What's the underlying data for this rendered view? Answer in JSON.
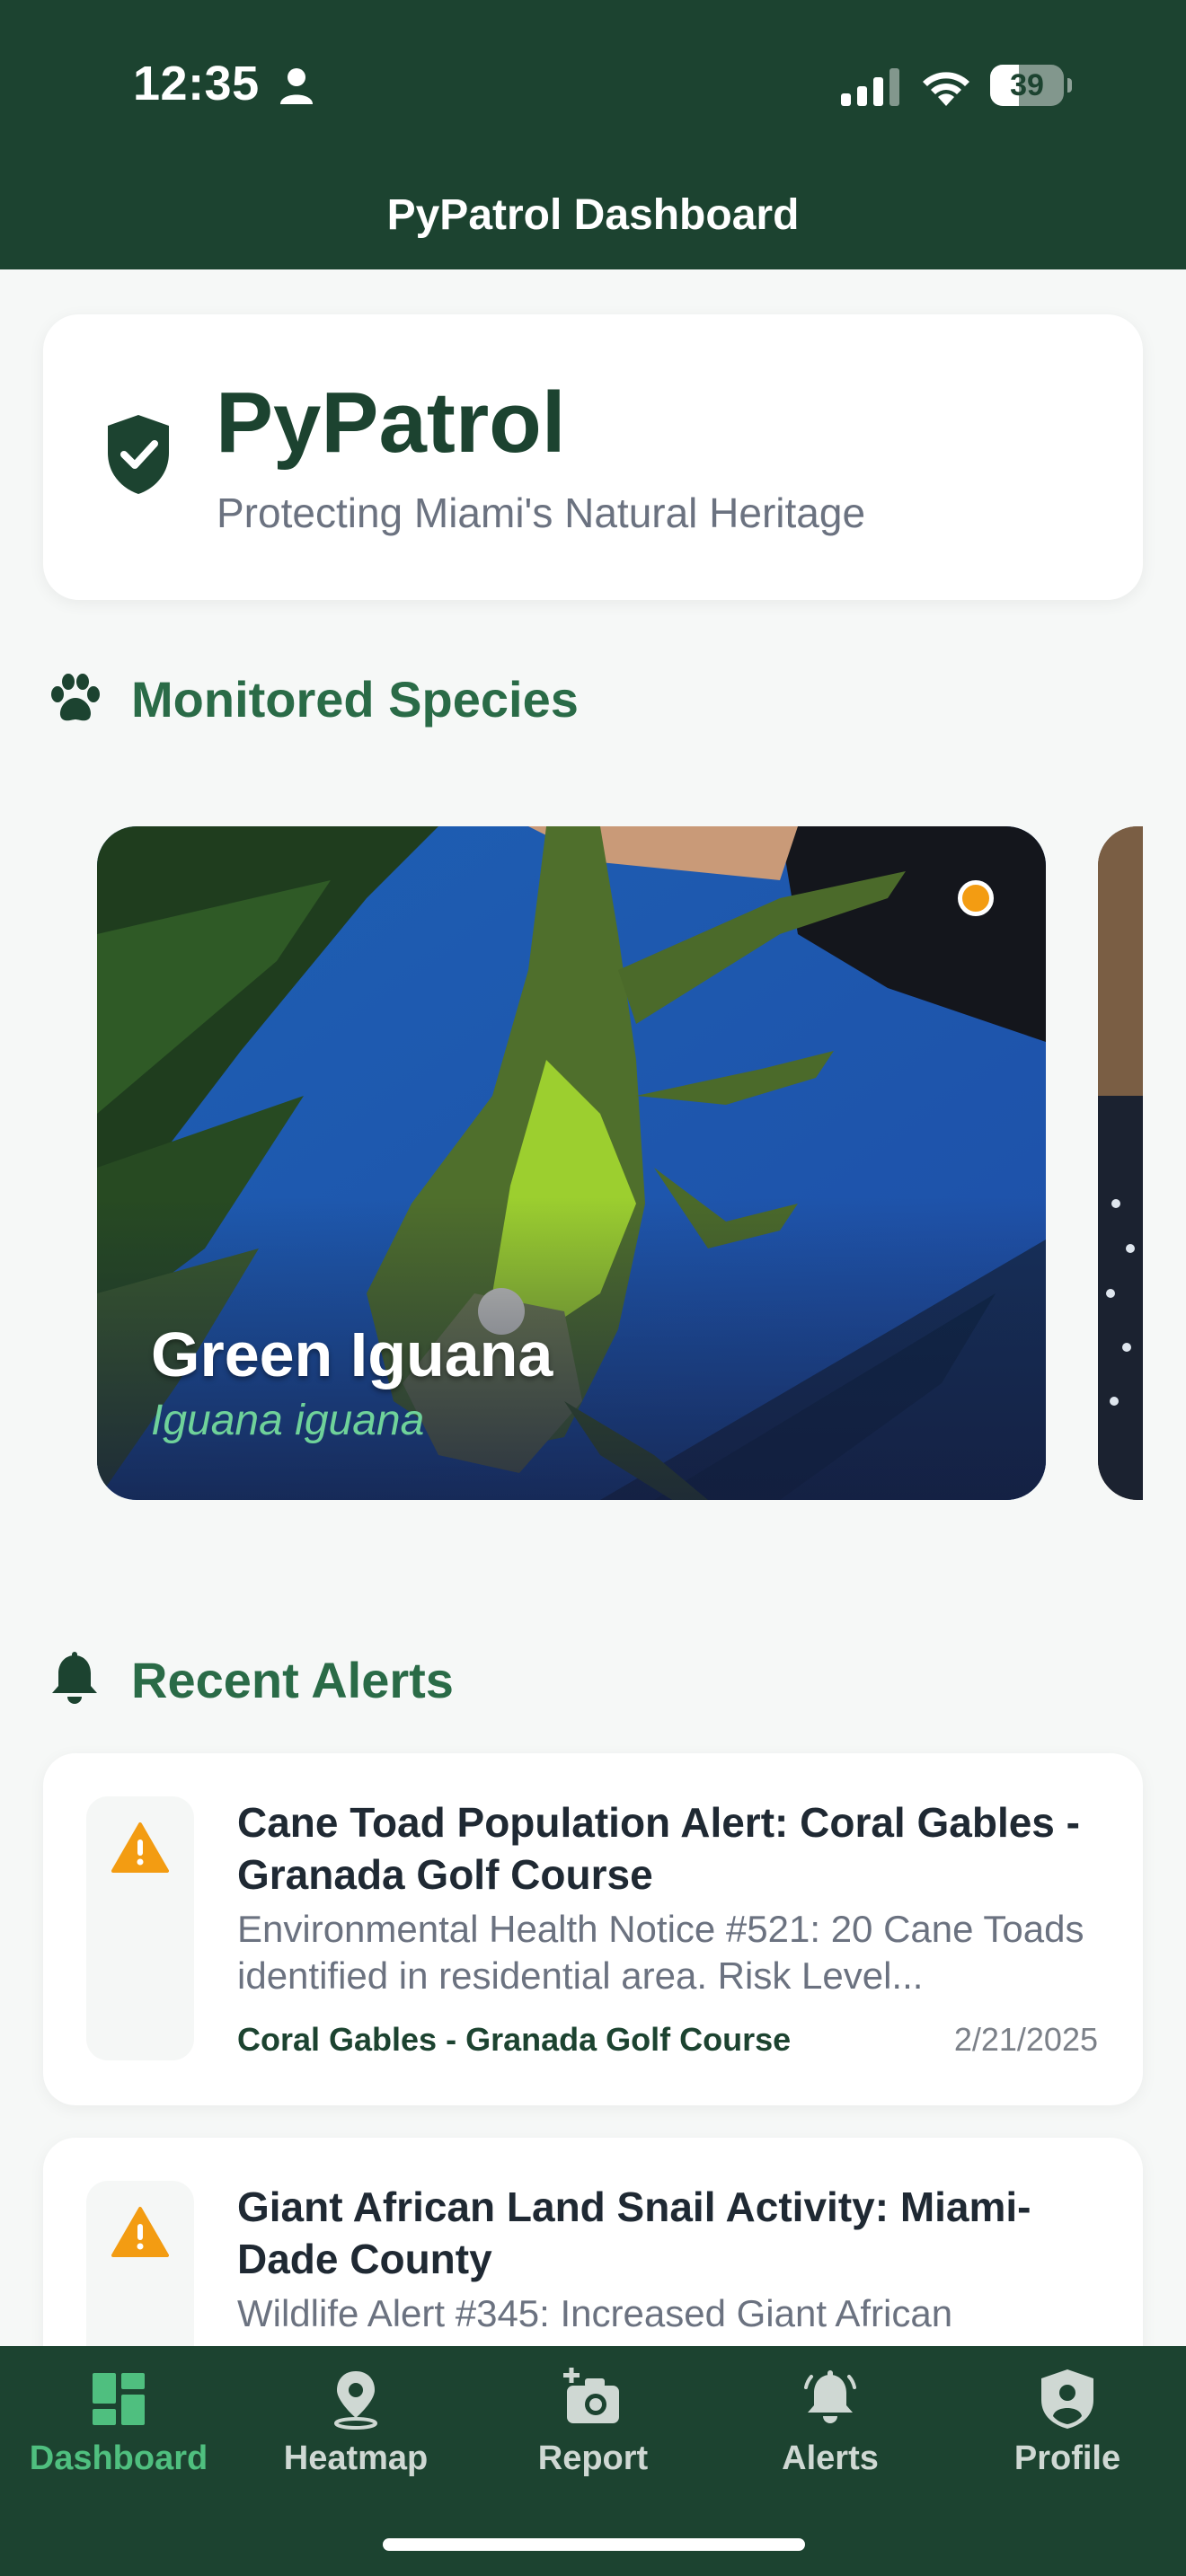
{
  "status_bar": {
    "time": "12:35",
    "battery_level": "39",
    "battery_fraction": 0.39
  },
  "header": {
    "title": "PyPatrol Dashboard"
  },
  "brand": {
    "name": "PyPatrol",
    "tagline": "Protecting Miami's Natural Heritage",
    "icon": "shield-check-icon"
  },
  "species_section": {
    "title": "Monitored Species",
    "icon": "paw-icon",
    "cards": [
      {
        "name": "Green Iguana",
        "latin": "Iguana iguana",
        "status_color": "#f39c12"
      }
    ]
  },
  "alerts_section": {
    "title": "Recent Alerts",
    "icon": "bell-icon",
    "items": [
      {
        "title": "Cane Toad Population Alert: Coral Gables - Granada Golf Course",
        "body": "Environmental Health Notice #521: 20 Cane Toads identified in residential area. Risk Level...",
        "location": "Coral Gables - Granada Golf Course",
        "date": "2/21/2025",
        "icon": "warning-icon"
      },
      {
        "title": "Giant African Land Snail Activity: Miami-Dade County",
        "body": "Wildlife Alert #345: Increased Giant African",
        "location": "",
        "date": "",
        "icon": "warning-icon"
      }
    ]
  },
  "tabbar": {
    "tabs": [
      {
        "label": "Dashboard",
        "icon": "dashboard-icon",
        "active": true
      },
      {
        "label": "Heatmap",
        "icon": "map-pin-icon",
        "active": false
      },
      {
        "label": "Report",
        "icon": "camera-plus-icon",
        "active": false
      },
      {
        "label": "Alerts",
        "icon": "bell-icon",
        "active": false
      },
      {
        "label": "Profile",
        "icon": "shield-user-icon",
        "active": false
      }
    ]
  },
  "colors": {
    "brand_dark": "#1c4330",
    "brand_green": "#2a6b47",
    "accent_green": "#4fbf7f",
    "warning": "#f39c12",
    "background": "#f6f8f7"
  }
}
